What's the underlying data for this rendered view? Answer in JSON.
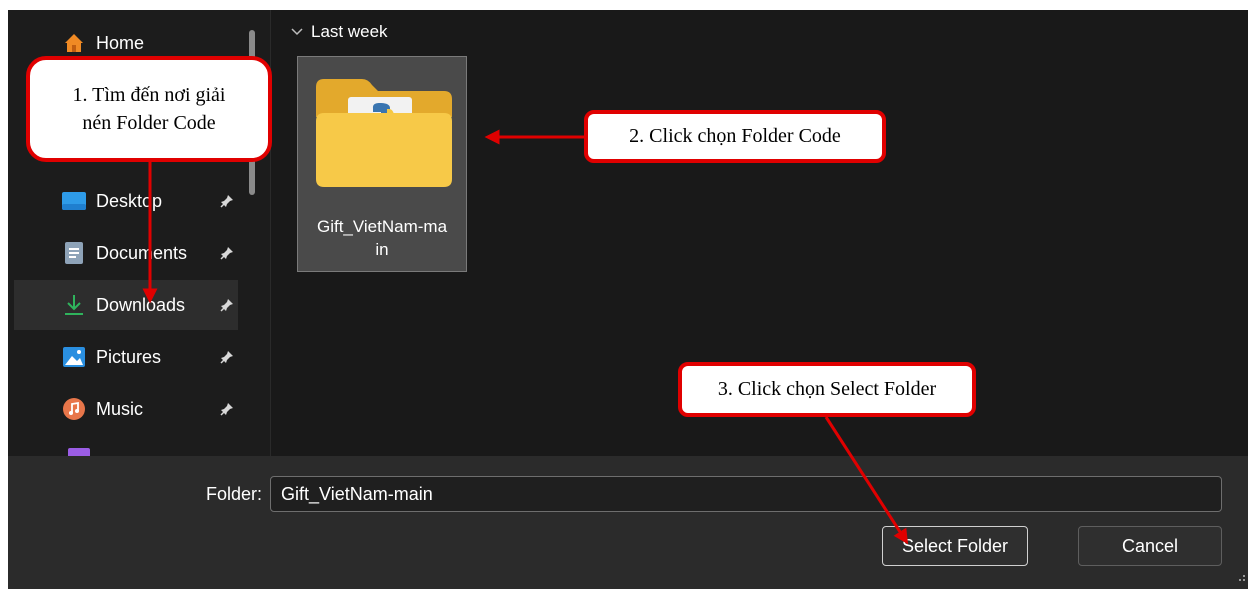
{
  "sidebar": {
    "items": [
      {
        "label": "Home",
        "icon": "home-icon",
        "pinned": false
      },
      {
        "label": "Desktop",
        "icon": "desktop-icon",
        "pinned": true
      },
      {
        "label": "Documents",
        "icon": "documents-icon",
        "pinned": true
      },
      {
        "label": "Downloads",
        "icon": "downloads-icon",
        "pinned": true,
        "selected": true
      },
      {
        "label": "Pictures",
        "icon": "pictures-icon",
        "pinned": true
      },
      {
        "label": "Music",
        "icon": "music-icon",
        "pinned": true
      }
    ]
  },
  "content": {
    "group_header": "Last week",
    "items": [
      {
        "name": "Gift_VietNam-ma\nin",
        "icon": "folder-python-icon"
      }
    ]
  },
  "footer": {
    "folder_label": "Folder:",
    "folder_value": "Gift_VietNam-main",
    "select_button": "Select Folder",
    "cancel_button": "Cancel"
  },
  "annotations": {
    "step1": "1. Tìm đến nơi giải\nnén Folder Code",
    "step2": "2. Click chọn Folder Code",
    "step3": "3. Click chọn Select Folder"
  },
  "colors": {
    "dialog_bg": "#1c1c1c",
    "footer_bg": "#2b2b2b",
    "annotation_red": "#e00000",
    "folder_yellow": "#f7c948",
    "downloads_green": "#2fb35c"
  }
}
